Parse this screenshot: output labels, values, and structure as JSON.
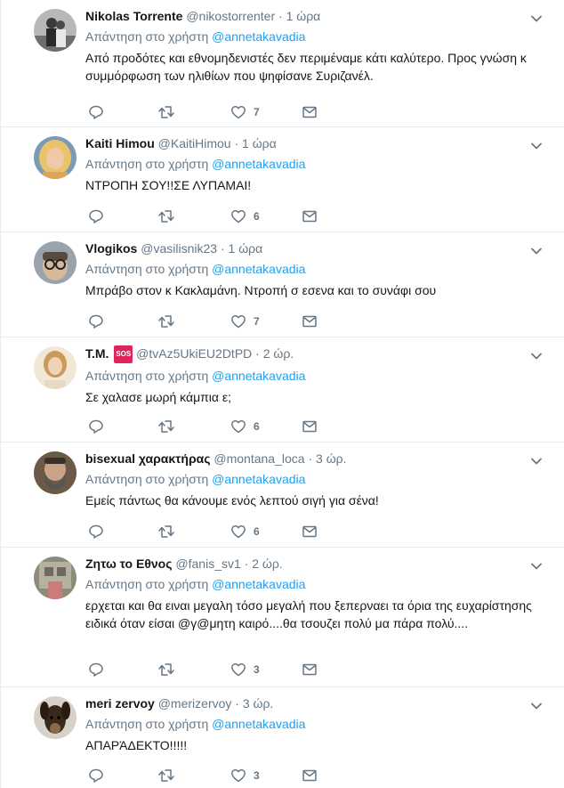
{
  "reply_prefix": "Απάντηση στο χρήστη",
  "reply_to": "@annetakavadia",
  "colors": {
    "link": "#1da1f2",
    "muted": "#657786",
    "text": "#14171a",
    "border": "#e6ecf0",
    "sos": "#e0245e"
  },
  "tweets": [
    {
      "name": "Nikolas Torrente",
      "handle": "@nikostorrenter",
      "time": "1 ώρα",
      "text": "Από προδότες και εθνομηδενιστές δεν περιμέναμε κάτι καλύτερο. Προς γνώση κ συμμόρφωση των ηλιθίων που ψηφίσανε Συριζανέλ.",
      "likes": "7",
      "avatar": "avatar-couple-photo"
    },
    {
      "name": "Kaiti Himou",
      "handle": "@KaitiHimou",
      "time": "1 ώρα",
      "text": "ΝΤΡΟΠΗ ΣΟΥ!!ΣΕ ΛΥΠΑΜΑΙ!",
      "likes": "6",
      "avatar": "avatar-blonde-woman"
    },
    {
      "name": "Vlogikos",
      "handle": "@vasilisnik23",
      "time": "1 ώρα",
      "text": "Μπράβο στον κ Κακλαμάνη. Ντροπή σ εσενα και το συνάφι σου",
      "likes": "7",
      "avatar": "avatar-man-with-glasses"
    },
    {
      "name": "T.M.",
      "badge": "SOS",
      "handle": "@tvAz5UkiEU2DtPD",
      "time": "2 ώρ.",
      "text": "Σε χαλασε μωρή κάμπια ε;",
      "likes": "6",
      "avatar": "avatar-woman-portrait"
    },
    {
      "name": "bisexual χαρακτήρας",
      "handle": "@montana_loca",
      "time": "3 ώρ.",
      "text": "Εμείς πάντως θα κάνουμε ενός λεπτού σιγή για σένα!",
      "likes": "6",
      "avatar": "avatar-bearded-man"
    },
    {
      "name": "Ζητω το Εθνος",
      "handle": "@fanis_sv1",
      "time": "2 ώρ.",
      "text": "ερχεται και θα ειναι μεγαλη τόσο μεγαλή που ξεπερναει τα όρια της ευχαρίστησης ειδικά όταν είσαι @γ@μητη καιρό....θα τσουζει πολύ μα πάρα πολύ....",
      "likes": "3",
      "avatar": "avatar-building-photo"
    },
    {
      "name": "meri zervoy",
      "handle": "@merizervoy",
      "time": "3 ώρ.",
      "text": "ΑΠΑΡΆΔΕΚΤΟ!!!!!",
      "likes": "3",
      "avatar": "avatar-dog"
    }
  ]
}
